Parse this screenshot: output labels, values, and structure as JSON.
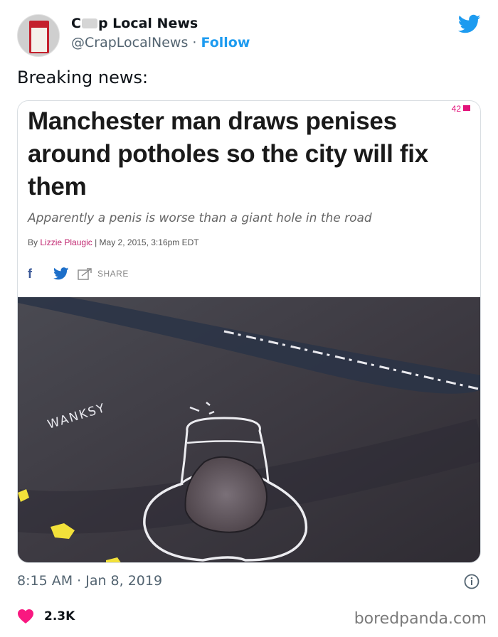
{
  "account": {
    "name_start": "C",
    "name_end": "p Local News",
    "handle": "@CrapLocalNews",
    "separator": "·",
    "follow_label": "Follow"
  },
  "tweet": {
    "text": "Breaking news:",
    "timestamp": "8:15 AM · Jan 8, 2019",
    "likes": "2.3K"
  },
  "article": {
    "headline": "Manchester man draws penises around potholes so the city will fix them",
    "comment_count": "42",
    "dek": "Apparently a penis is worse than a giant hole in the road",
    "byline_prefix": "By",
    "author": "Lizzie Plaugic",
    "byline_sep": "|",
    "date": "May 2, 2015, 3:16pm EDT",
    "share_label": "SHARE",
    "facebook_glyph": "f"
  },
  "photo": {
    "chalk_text": "WANKSY"
  },
  "watermark": "boredpanda.com",
  "colors": {
    "follow_blue": "#1d9bf0",
    "heart_red": "#f91880",
    "author_pink": "#c0246f"
  },
  "icons": [
    "twitter-bird-icon",
    "facebook-icon",
    "twitter-icon",
    "share-icon",
    "info-icon",
    "heart-icon"
  ]
}
